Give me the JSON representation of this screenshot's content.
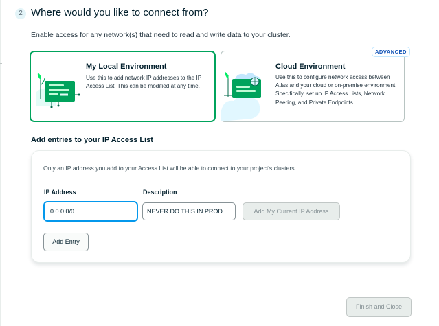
{
  "step": {
    "number": "2",
    "title": "Where would you like to connect from?",
    "description": "Enable access for any network(s) that need to read and write data to your cluster."
  },
  "environments": {
    "local": {
      "title": "My Local Environment",
      "description": "Use this to add network IP addresses to the IP Access List. This can be modified at any time.",
      "selected": true,
      "icon": "local-environment-illustration"
    },
    "cloud": {
      "title": "Cloud Environment",
      "description": "Use this to configure network access between Atlas and your cloud or on-premise environment. Specifically, set up IP Access Lists, Network Peering, and Private Endpoints.",
      "badge": "ADVANCED",
      "selected": false,
      "icon": "cloud-environment-illustration"
    }
  },
  "access_list": {
    "heading": "Add entries to your IP Access List",
    "note": "Only an IP address you add to your Access List will be able to connect to your project's clusters.",
    "ip_label": "IP Address",
    "ip_value": "0.0.0.0/0",
    "description_label": "Description",
    "description_value": "NEVER DO THIS IN PROD",
    "add_current_ip_label": "Add My Current IP Address",
    "add_entry_label": "Add Entry"
  },
  "footer": {
    "finish_label": "Finish and Close"
  },
  "colors": {
    "selected_border": "#00a35c",
    "focus_border": "#0498ec",
    "badge_text": "#1254b7",
    "disabled_bg": "#e8edeb"
  }
}
